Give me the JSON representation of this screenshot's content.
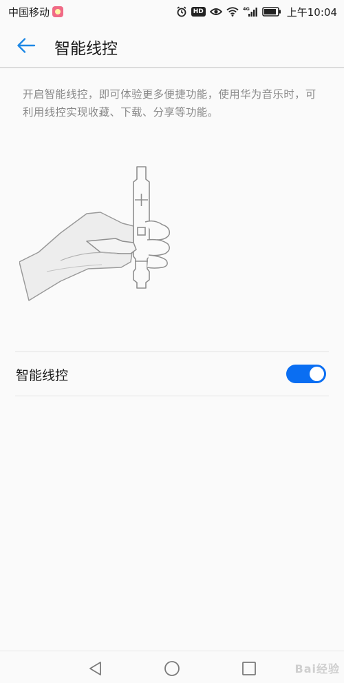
{
  "status_bar": {
    "carrier": "中国移动",
    "network_label": "4G",
    "hd_label": "HD",
    "time": "上午10:04"
  },
  "header": {
    "title": "智能线控"
  },
  "description": "开启智能线控，即可体验更多便捷功能，使用华为音乐时，可利用线控实现收藏、下载、分享等功能。",
  "setting": {
    "label": "智能线控",
    "enabled": true
  },
  "watermark": "Bai经验",
  "colors": {
    "accent": "#0a6ef2",
    "back_arrow": "#1e88e5",
    "background": "#fafafa"
  }
}
